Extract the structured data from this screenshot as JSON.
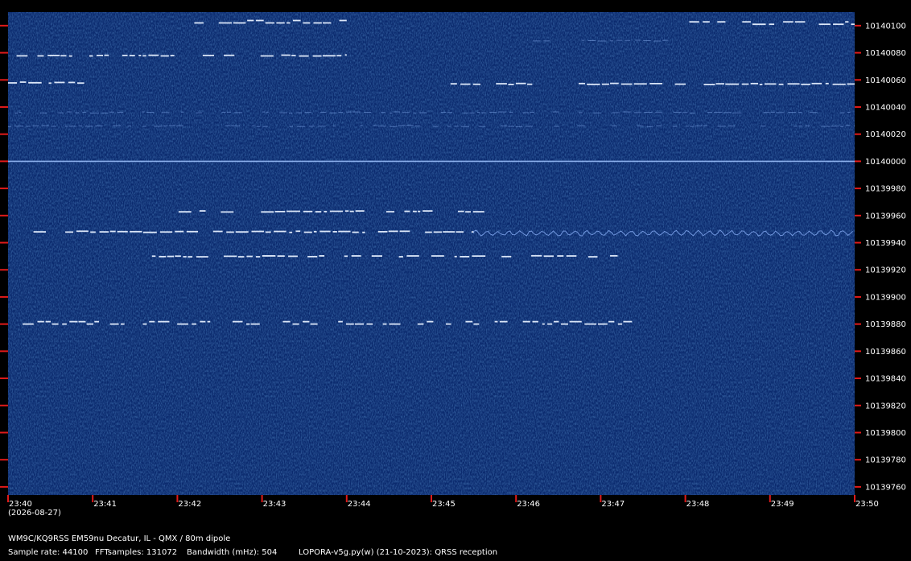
{
  "colors": {
    "background": "#000000",
    "waterfall": "#0b2a6e",
    "signal": "#e6f0ff",
    "tick": "#e01a1a"
  },
  "header": {
    "date": "(2026-08-27)",
    "station": "WM9C/KQ9RSS EM59nu Decatur, IL - QMX / 80m dipole",
    "sample_rate": "Sample rate: 44100",
    "fft_samples": "FFTsamples: 131072",
    "bandwidth": "Bandwidth (mHz): 504",
    "software": "LOPORA-v5g.py(w) (21-10-2023): QRSS reception"
  },
  "chart_data": {
    "type": "heatmap",
    "title": "",
    "xlabel": "",
    "ylabel": "",
    "x_ticks": [
      "23:40",
      "23:41",
      "23:42",
      "23:43",
      "23:44",
      "23:45",
      "23:46",
      "23:47",
      "23:48",
      "23:49",
      "23:50"
    ],
    "y_ticks": [
      10140100,
      10140080,
      10140060,
      10140040,
      10140020,
      10140000,
      10139980,
      10139960,
      10139940,
      10139920,
      10139900,
      10139880,
      10139860,
      10139840,
      10139820,
      10139800,
      10139780,
      10139760
    ],
    "y_tick_labels": [
      "10140100",
      "10140080",
      "10140060",
      "10140040",
      "10140020",
      "10140000",
      "10139980",
      "10139960",
      "10139940",
      "10139920",
      "10139900",
      "10139880",
      "10139860",
      "10139840",
      "10139820",
      "10139800",
      "10139780",
      "10139760"
    ],
    "xlim_minutes": [
      0,
      10
    ],
    "ylim_hz": [
      10139754,
      10140110
    ],
    "traces": [
      {
        "start": 0.0,
        "end": 10.0,
        "freq": 10140000,
        "style": "carrier"
      },
      {
        "start": 1.9,
        "end": 6.0,
        "freq": 10139963,
        "style": "qrss"
      },
      {
        "start": 0.3,
        "end": 5.5,
        "freq": 10139948,
        "style": "qrss"
      },
      {
        "start": 5.5,
        "end": 10.0,
        "freq": 10139947,
        "style": "wobble"
      },
      {
        "start": 1.7,
        "end": 7.2,
        "freq": 10139930,
        "style": "qrss"
      },
      {
        "start": 0.0,
        "end": 7.4,
        "freq": 10139880,
        "style": "fsk"
      },
      {
        "start": 0.0,
        "end": 10.0,
        "freq": 10140026,
        "style": "faint"
      },
      {
        "start": 0.0,
        "end": 0.9,
        "freq": 10140058,
        "style": "qrss"
      },
      {
        "start": 5.1,
        "end": 10.0,
        "freq": 10140057,
        "style": "qrss"
      },
      {
        "start": 0.1,
        "end": 4.0,
        "freq": 10140078,
        "style": "qrss"
      },
      {
        "start": 2.2,
        "end": 4.0,
        "freq": 10140102,
        "style": "fsk"
      },
      {
        "start": 7.8,
        "end": 10.0,
        "freq": 10140101,
        "style": "fsk"
      },
      {
        "start": 6.1,
        "end": 7.8,
        "freq": 10140089,
        "style": "faint"
      },
      {
        "start": 0.0,
        "end": 10.0,
        "freq": 10140036,
        "style": "faint"
      }
    ]
  }
}
